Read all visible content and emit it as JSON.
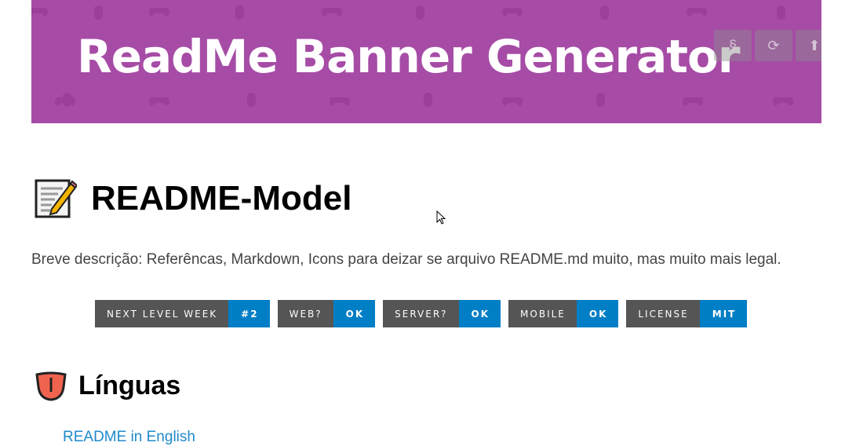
{
  "banner": {
    "title": "ReadMe Banner Generator",
    "background_color": "#a64ca6",
    "buttons": [
      {
        "icon": "section-sign-icon",
        "glyph": "§"
      },
      {
        "icon": "refresh-icon",
        "glyph": "⟳"
      },
      {
        "icon": "upload-arrow-icon",
        "glyph": "⬆"
      }
    ]
  },
  "main": {
    "title_icon": "memo-icon",
    "title": "README-Model",
    "description": "Breve descrição: Referêncas, Markdown, Icons para deizar se arquivo README.md muito, mas muito mais legal.",
    "badges": [
      {
        "label": "NEXT LEVEL WEEK",
        "value": "#2"
      },
      {
        "label": "WEB?",
        "value": "OK"
      },
      {
        "label": "SERVER?",
        "value": "OK"
      },
      {
        "label": "MOBILE",
        "value": "OK"
      },
      {
        "label": "LICENSE",
        "value": "MIT"
      }
    ],
    "badge_colors": {
      "label_bg": "#555555",
      "value_bg": "#007ec6"
    },
    "section_icon": "tongue-icon",
    "section_title": "Línguas",
    "link_text": "README in English"
  }
}
